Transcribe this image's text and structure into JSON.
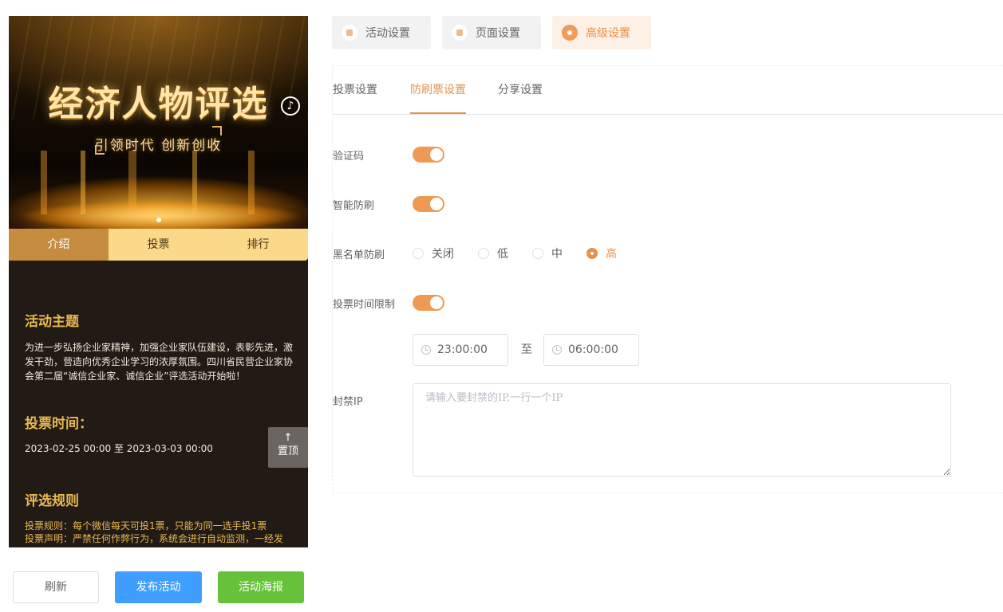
{
  "preview": {
    "banner_title": "经济人物评选",
    "banner_subtitle": "引领时代  创新创收",
    "music_icon": "music-note-icon",
    "tabs": [
      {
        "label": "介绍",
        "active": true
      },
      {
        "label": "投票",
        "active": false
      },
      {
        "label": "排行",
        "active": false
      }
    ],
    "theme_title": "活动主题",
    "theme_text": "为进一步弘扬企业家精神，加强企业家队伍建设，表彰先进，激发干劲，营造向优秀企业学习的浓厚氛围。四川省民营企业家协会第二届“诚信企业家、诚信企业”评选活动开始啦！",
    "time_title": "投票时间：",
    "time_text": "2023-02-25 00:00 至 2023-03-03 00:00",
    "rule_title": "评选规则",
    "rule_line1": "投票规则：每个微信每天可投1票，只能为同一选手投1票",
    "rule_line2": "投票声明：严禁任何作弊行为，系统会进行自动监测，一经发",
    "back_top_arrow": "↑",
    "back_top_label": "置顶"
  },
  "actions": {
    "refresh": "刷新",
    "publish": "发布活动",
    "poster": "活动海报"
  },
  "top_tabs": [
    {
      "label": "活动设置",
      "icon": "activity-icon"
    },
    {
      "label": "页面设置",
      "icon": "page-icon"
    },
    {
      "label": "高级设置",
      "icon": "advanced-icon",
      "active": true
    }
  ],
  "sub_tabs": [
    {
      "label": "投票设置"
    },
    {
      "label": "防刷票设置",
      "active": true
    },
    {
      "label": "分享设置"
    }
  ],
  "settings": {
    "captcha_label": "验证码",
    "captcha_on": true,
    "smart_label": "智能防刷",
    "smart_on": true,
    "blacklist_label": "黑名单防刷",
    "blacklist_options": [
      "关闭",
      "低",
      "中",
      "高"
    ],
    "blacklist_selected": "高",
    "time_limit_label": "投票时间限制",
    "time_limit_on": true,
    "time_start": "23:00:00",
    "time_to": "至",
    "time_end": "06:00:00",
    "ip_label": "封禁IP",
    "ip_placeholder": "请输入要封禁的IP,一行一个IP",
    "ip_value": ""
  },
  "colors": {
    "accent": "#e6914b",
    "switch_on": "#ee9a55",
    "publish": "#409eff",
    "poster": "#67c23a",
    "preview_bg": "#211a15",
    "preview_gold": "#e9b94f"
  }
}
